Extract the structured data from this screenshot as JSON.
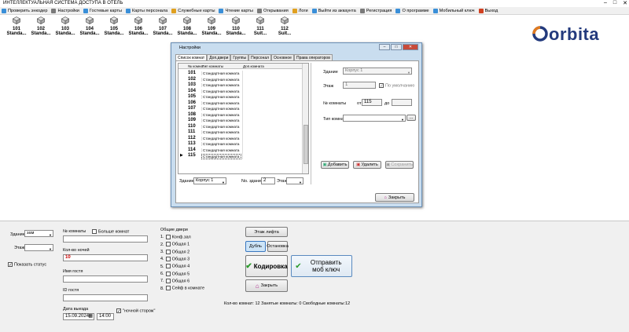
{
  "window": {
    "title": "ИНТЕЛЛЕКТУАЛЬНАЯ СИСТЕМА ДОСТУПА В ОТЕЛЬ"
  },
  "menu": [
    {
      "label": "Проверить энкодер",
      "color": "#3a8fd8"
    },
    {
      "label": "Настройки",
      "color": "#7a7a7a"
    },
    {
      "label": "Гостевые карты",
      "color": "#3a8fd8"
    },
    {
      "label": "Карты персонала",
      "color": "#3a8fd8"
    },
    {
      "label": "Служебные карты",
      "color": "#e0a020"
    },
    {
      "label": "Чтение карты",
      "color": "#3a8fd8"
    },
    {
      "label": "Открывания",
      "color": "#7a7a7a"
    },
    {
      "label": "Логи",
      "color": "#e0a020"
    },
    {
      "label": "Выйти из аккаунта",
      "color": "#3a8fd8"
    },
    {
      "label": "Регистрация",
      "color": "#7a7a7a"
    },
    {
      "label": "О программе",
      "color": "#3a8fd8"
    },
    {
      "label": "Мобильный ключ",
      "color": "#3a8fd8"
    },
    {
      "label": "Выход",
      "color": "#d04020"
    }
  ],
  "rooms": [
    {
      "num": "101",
      "name": "Standa..."
    },
    {
      "num": "102",
      "name": "Standa..."
    },
    {
      "num": "103",
      "name": "Standa..."
    },
    {
      "num": "104",
      "name": "Standa..."
    },
    {
      "num": "105",
      "name": "Standa..."
    },
    {
      "num": "106",
      "name": "Standa..."
    },
    {
      "num": "107",
      "name": "Standa..."
    },
    {
      "num": "108",
      "name": "Standa..."
    },
    {
      "num": "109",
      "name": "Standa..."
    },
    {
      "num": "110",
      "name": "Standa..."
    },
    {
      "num": "111",
      "name": "Suit..."
    },
    {
      "num": "112",
      "name": "Suit..."
    }
  ],
  "logo": {
    "text": "orbita",
    "color": "#233a7d"
  },
  "dialog": {
    "title": "Настройки",
    "tabs": [
      "Список комнат",
      "Доп.двери",
      "Группы",
      "Персонал",
      "Основное",
      "Права операторов"
    ],
    "grid": {
      "headers": [
        "№ комна",
        "Тип комнаты",
        "Доп.комната"
      ],
      "rows": [
        {
          "num": "101",
          "type": "Стандартная комната"
        },
        {
          "num": "102",
          "type": "Стандартная комната"
        },
        {
          "num": "103",
          "type": "Стандартная комната"
        },
        {
          "num": "104",
          "type": "Стандартная комната"
        },
        {
          "num": "105",
          "type": "Стандартная комната"
        },
        {
          "num": "106",
          "type": "Стандартная комната"
        },
        {
          "num": "107",
          "type": "Стандартная комната"
        },
        {
          "num": "108",
          "type": "Стандартная комната"
        },
        {
          "num": "109",
          "type": "Стандартная комната"
        },
        {
          "num": "110",
          "type": "Стандартная комната"
        },
        {
          "num": "111",
          "type": "Стандартная комната"
        },
        {
          "num": "112",
          "type": "Стандартная комната"
        },
        {
          "num": "113",
          "type": "Стандартная комната"
        },
        {
          "num": "114",
          "type": "Стандартная комната"
        },
        {
          "num": "115",
          "type": "Стандартная комната"
        }
      ],
      "selected_marker": "▶"
    },
    "filter": {
      "building_label": "Здание",
      "building_value": "Корпус 1",
      "building_no_label": "No. здания",
      "building_no_value": "2",
      "floor_label": "Этаж"
    },
    "right": {
      "building_label": "Здание",
      "building_value": "Корпус 1",
      "floor_label": "Этаж",
      "floor_value": "1",
      "default_label": "По умолчанию",
      "rooms_label": "№ комнаты",
      "from_label": "от",
      "from_value": "115",
      "to_label": "до",
      "roomtype_label": "Тип комнат",
      "more": "..."
    },
    "buttons": {
      "add": "Добавить",
      "delete": "Удалить",
      "save": "Сохранить",
      "close": "Закрыть"
    }
  },
  "bottom": {
    "building_label": "Здание",
    "building_value": "зам",
    "floor_label": "Этаж",
    "show_status": "Показать статус",
    "room_no_label": "№ комнаты",
    "more_rooms": "Больше комнат",
    "nights_label": "Кол-во ночей",
    "nights_value": "10",
    "guest_name_label": "Имя гостя",
    "guest_id_label": "ID гостя",
    "checkout_label": "Дата выезда",
    "checkout_date": "15.09.2024",
    "checkout_time": "14:00",
    "night_guard": "\"ночной сторож\"",
    "common_doors_label": "Общие двери",
    "doors": [
      "Конф.зал",
      "Общая 1",
      "Общая 2",
      "Общая 3",
      "Общая 4",
      "Общая 5",
      "Общая 6",
      "Сейф в комнате"
    ],
    "btn_floor_lift": "Этаж лифта",
    "btn_duplicate": "Дубль",
    "btn_stop": "Остановка",
    "btn_encode": "Кодировка",
    "btn_send_mobile": "Отправить моб ключ",
    "btn_close": "Закрыть",
    "stats": "Кол-во комнат: 12  Занятые комнаты: 0  Свободные комнаты:12"
  }
}
